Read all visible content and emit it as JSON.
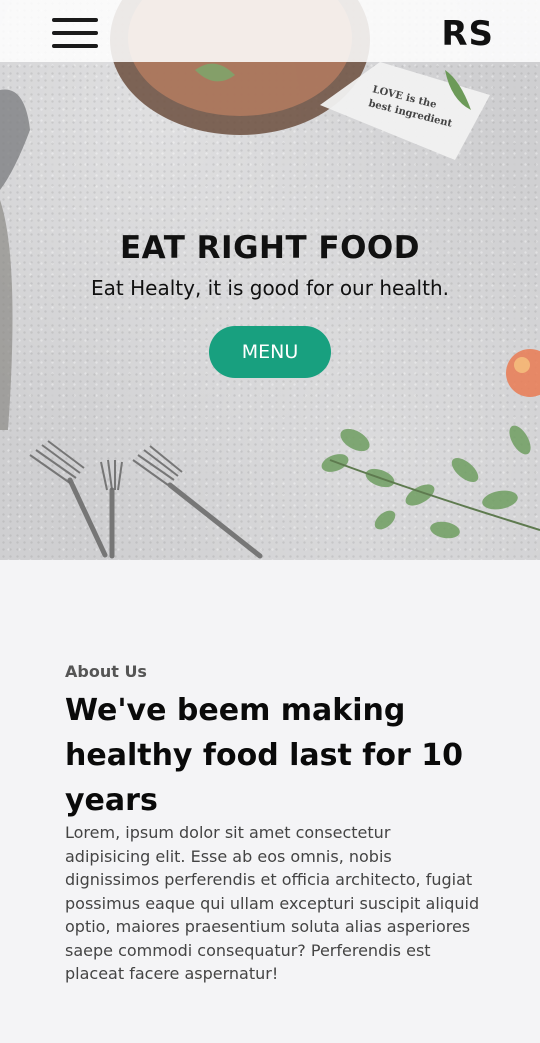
{
  "navbar": {
    "brand": "RS",
    "menu_icon": "hamburger-menu-icon"
  },
  "hero": {
    "title": "EAT RIGHT FOOD",
    "subtitle": "Eat Healty, it is good for our health.",
    "button_label": "MENU",
    "napkin_text": "LOVE is the best ingredient"
  },
  "about": {
    "label": "About Us",
    "heading": "We've beem making healthy food last for 10 years",
    "body": "Lorem, ipsum dolor sit amet consectetur adipisicing elit. Esse ab eos omnis, nobis dignissimos perferendis et officia architecto, fugiat possimus eaque qui ullam excepturi suscipit aliquid optio, maiores praesentium soluta alias asperiores saepe commodi consequatur? Perferendis est placeat facere aspernatur!"
  },
  "colors": {
    "accent": "#18a07f",
    "page_background": "#f4f4f6"
  }
}
